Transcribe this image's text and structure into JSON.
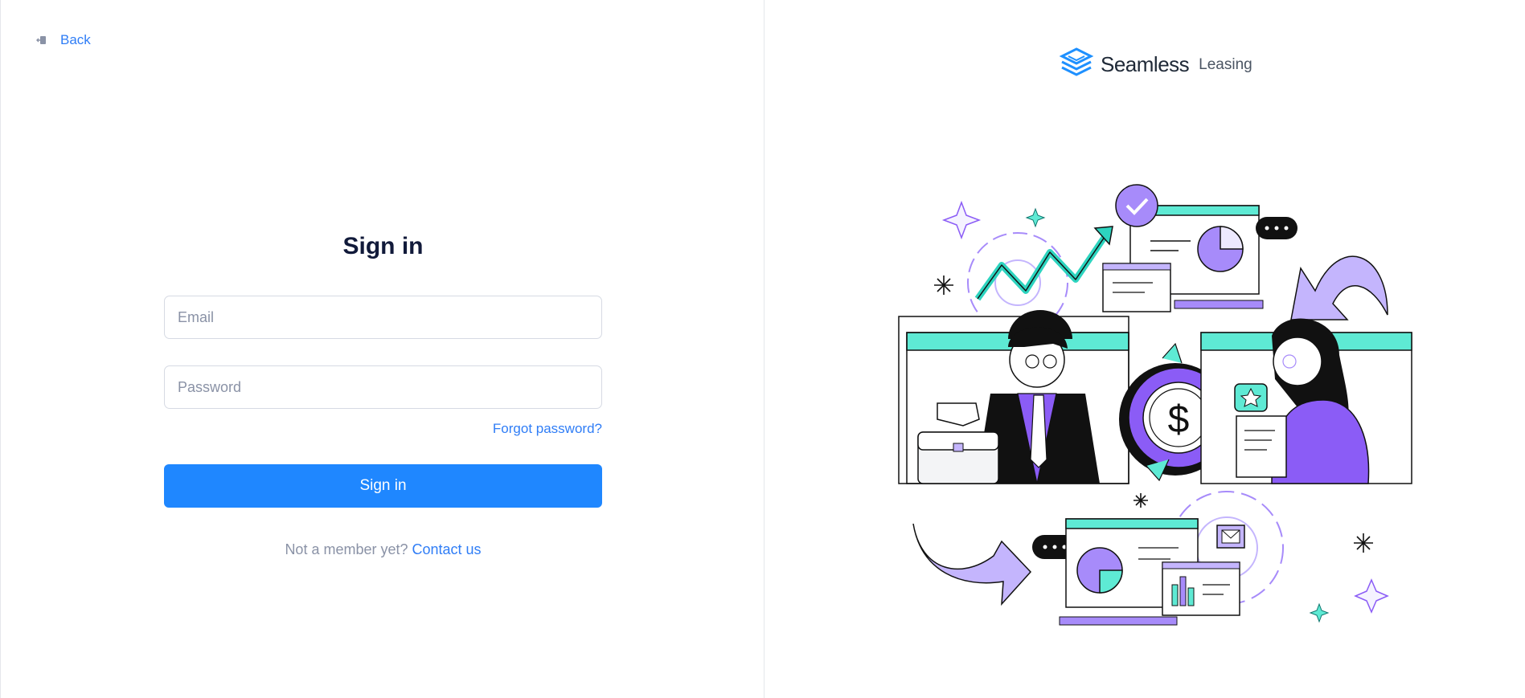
{
  "nav": {
    "back_label": "Back"
  },
  "signin": {
    "title": "Sign in",
    "email_placeholder": "Email",
    "password_placeholder": "Password",
    "forgot_label": "Forgot password?",
    "button_label": "Sign in",
    "member_text": "Not a member yet?",
    "contact_label": "Contact us"
  },
  "brand": {
    "name": "Seamless",
    "sub": "Leasing"
  },
  "colors": {
    "accent": "#1f87ff",
    "link": "#2f7df6",
    "purple": "#8b5cf6",
    "teal": "#2dd4bf"
  }
}
